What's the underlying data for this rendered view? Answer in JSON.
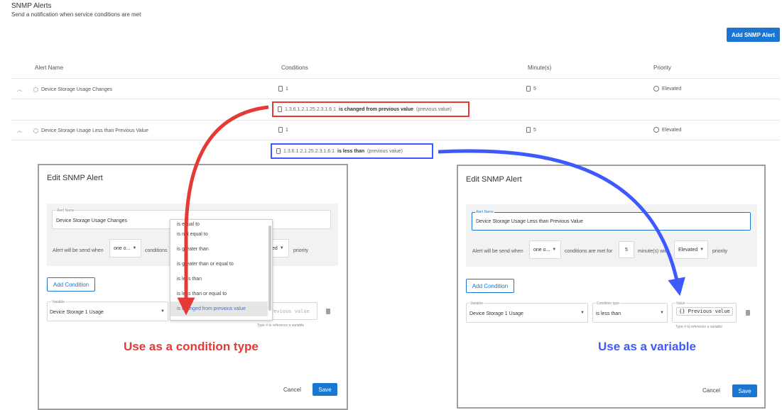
{
  "header": {
    "title": "SNMP Alerts",
    "subtitle": "Send a notification when service conditions are met",
    "add_button": "Add SNMP Alert"
  },
  "table": {
    "columns": [
      "Alert Name",
      "Conditions",
      "Minute(s)",
      "Priority"
    ],
    "rows": [
      {
        "name": "Device Storage Usage Changes",
        "conditions": "1",
        "minutes": "5",
        "priority": "Elevated",
        "expanded": {
          "oid": "1.3.6.1.2.1.25.2.3.1.6.1",
          "operator": "is changed from previous value",
          "value": "(previous value)"
        }
      },
      {
        "name": "Device Storage Usage Less than Previous Value",
        "conditions": "1",
        "minutes": "5",
        "priority": "Elevated",
        "expanded": {
          "oid": "1.3.6.1.2.1.25.2.3.1.6.1",
          "operator": "is less than",
          "value": "(previous value)"
        }
      }
    ]
  },
  "dialog_left": {
    "title": "Edit SNMP Alert",
    "alert_name_label": "Alert Name",
    "alert_name_value": "Device Storage Usage Changes",
    "send_prefix": "Alert will be send when",
    "match_select": "one o...",
    "conditions_word": "conditions",
    "priority_select": "ed",
    "priority_suffix": "priority",
    "add_condition": "Add Condition",
    "variable_label": "Variable",
    "variable_value": "Device Storage 1 Usage",
    "value_placeholder": "revious value",
    "value_hint": "Type # to reference a variable",
    "dropdown_items": [
      "is equal to",
      "is not equal to",
      "is greater than",
      "is greater than or equal to",
      "is less than",
      "is less than or equal to",
      "is changed from previous value"
    ],
    "cancel": "Cancel",
    "save": "Save",
    "caption": "Use as a condition type"
  },
  "dialog_right": {
    "title": "Edit SNMP Alert",
    "alert_name_label": "Alert Name",
    "alert_name_value": "Device Storage Usage Less than Previous Value",
    "send_prefix": "Alert will be send when",
    "match_select": "one o...",
    "conditions_text": "conditions are met for",
    "minutes_value": "5",
    "minutes_suffix": "minute(s) with",
    "priority_select": "Elevated",
    "priority_suffix": "priority",
    "add_condition": "Add Condition",
    "variable_label": "Variable",
    "variable_value": "Device Storage 1 Usage",
    "condition_type_label": "Condition type",
    "condition_type_value": "is less than",
    "value_label": "Value",
    "value_chip": "{} Previous value",
    "value_hint": "Type # to reference a variable",
    "cancel": "Cancel",
    "save": "Save",
    "caption": "Use as a variable"
  },
  "colors": {
    "primary": "#1976d2",
    "annotation_red": "#e53935",
    "annotation_blue": "#3d5afe"
  }
}
